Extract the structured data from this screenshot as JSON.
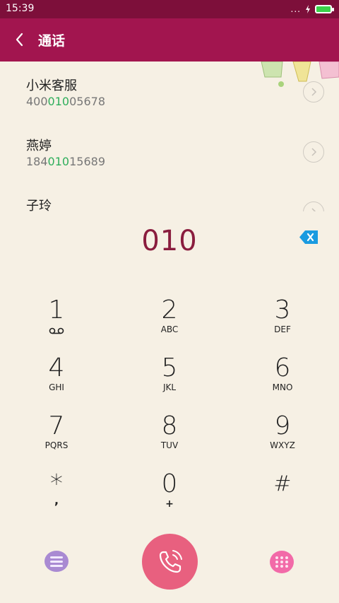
{
  "status_bar": {
    "time": "15:39",
    "signal_dots": "...",
    "battery_color": "#3ad24a"
  },
  "app_bar": {
    "title": "通话",
    "color": "#a2154f"
  },
  "results": [
    {
      "name": "小米客服",
      "number_pre": "400",
      "number_match": "010",
      "number_post": "05678"
    },
    {
      "name": "燕婷",
      "number_pre": "184",
      "number_match": "010",
      "number_post": "15689"
    },
    {
      "name": "子玲",
      "number_pre": "",
      "number_match": "",
      "number_post": ""
    }
  ],
  "dialer": {
    "input": "010",
    "digit_color": "#8a1d3e"
  },
  "keypad": [
    {
      "digit": "1",
      "sub": ""
    },
    {
      "digit": "2",
      "sub": "ABC"
    },
    {
      "digit": "3",
      "sub": "DEF"
    },
    {
      "digit": "4",
      "sub": "GHI"
    },
    {
      "digit": "5",
      "sub": "JKL"
    },
    {
      "digit": "6",
      "sub": "MNO"
    },
    {
      "digit": "7",
      "sub": "PQRS"
    },
    {
      "digit": "8",
      "sub": "TUV"
    },
    {
      "digit": "9",
      "sub": "WXYZ"
    },
    {
      "digit": "*",
      "sub": ","
    },
    {
      "digit": "0",
      "sub": "+"
    },
    {
      "digit": "#",
      "sub": ""
    }
  ],
  "bottom": {
    "menu_icon": "menu-icon",
    "call_icon": "phone-icon",
    "keypad_icon": "keypad-icon",
    "call_color": "#e8607f"
  }
}
